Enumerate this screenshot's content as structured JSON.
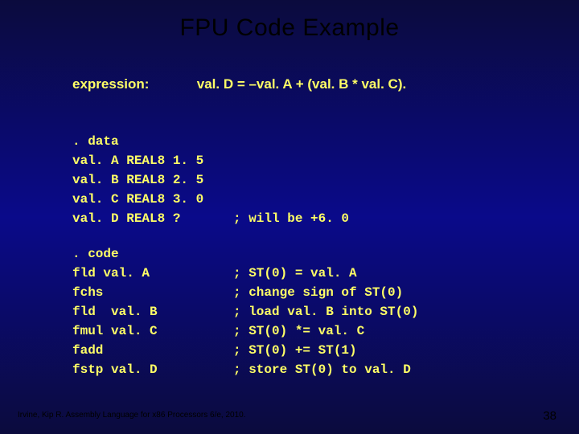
{
  "title": "FPU Code Example",
  "expression": {
    "label": "expression:",
    "text": "val. D = –val. A  + (val. B * val. C)."
  },
  "data_block": {
    "header": ". data",
    "lines": [
      {
        "decl": "val. A REAL8 1. 5",
        "comment": ""
      },
      {
        "decl": "val. B REAL8 2. 5",
        "comment": ""
      },
      {
        "decl": "val. C REAL8 3. 0",
        "comment": ""
      },
      {
        "decl": "val. D REAL8 ?",
        "comment": "; will be +6. 0"
      }
    ]
  },
  "code_block": {
    "header": ". code",
    "lines": [
      {
        "instr": "fld val. A",
        "comment": "; ST(0) = val. A"
      },
      {
        "instr": "fchs",
        "comment": "; change sign of ST(0)"
      },
      {
        "instr": "fld  val. B",
        "comment": "; load val. B into ST(0)"
      },
      {
        "instr": "fmul val. C",
        "comment": "; ST(0) *= val. C"
      },
      {
        "instr": "fadd",
        "comment": "; ST(0) += ST(1)"
      },
      {
        "instr": "fstp val. D",
        "comment": "; store ST(0) to val. D"
      }
    ]
  },
  "footer": "Irvine, Kip R. Assembly Language for x86 Processors 6/e, 2010.",
  "pagenum": "38"
}
